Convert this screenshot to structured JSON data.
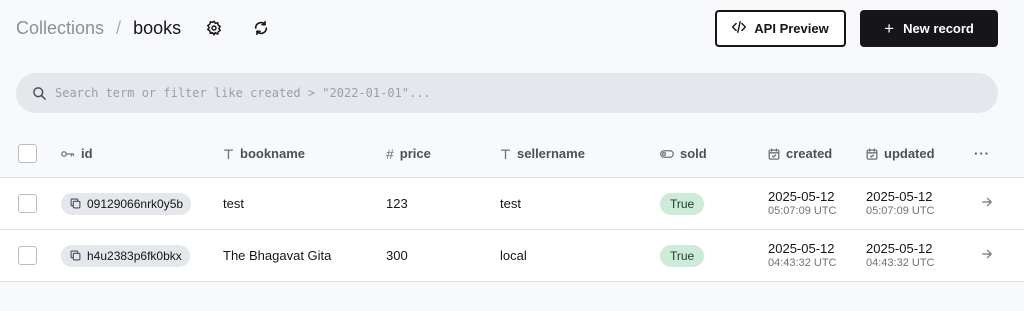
{
  "header": {
    "parent": "Collections",
    "separator": "/",
    "current": "books",
    "api_preview_label": "API Preview",
    "new_record_label": "New record"
  },
  "search": {
    "placeholder": "Search term or filter like created > \"2022-01-01\"..."
  },
  "table": {
    "columns": {
      "id": "id",
      "bookname": "bookname",
      "price": "price",
      "sellername": "sellername",
      "sold": "sold",
      "created": "created",
      "updated": "updated",
      "more": "···"
    },
    "rows": [
      {
        "id": "09129066nrk0y5b",
        "bookname": "test",
        "price": "123",
        "sellername": "test",
        "sold": "True",
        "created_date": "2025-05-12",
        "created_time": "05:07:09 UTC",
        "updated_date": "2025-05-12",
        "updated_time": "05:07:09 UTC"
      },
      {
        "id": "h4u2383p6fk0bkx",
        "bookname": "The Bhagavat Gita",
        "price": "300",
        "sellername": "local",
        "sold": "True",
        "created_date": "2025-05-12",
        "created_time": "04:43:32 UTC",
        "updated_date": "2025-05-12",
        "updated_time": "04:43:32 UTC"
      }
    ]
  },
  "colors": {
    "background": "#f8f9fa",
    "primary": "#16161a",
    "badge_true": "#cdebd8",
    "search_bg": "#e4e7eb"
  },
  "icons": [
    "gear-icon",
    "refresh-icon",
    "code-icon",
    "plus-icon",
    "search-icon",
    "key-icon",
    "text-icon",
    "hash-icon",
    "toggle-icon",
    "calendar-icon",
    "copy-icon",
    "arrow-right-icon"
  ]
}
